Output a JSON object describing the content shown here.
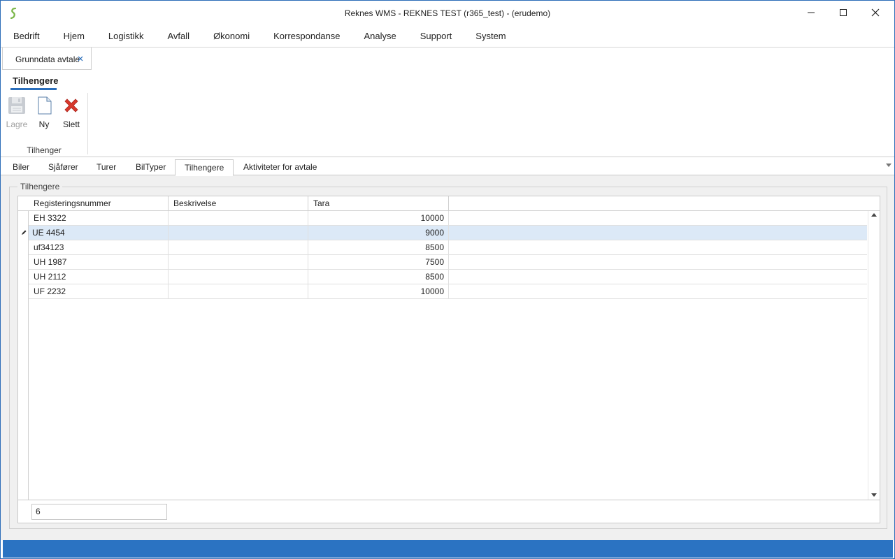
{
  "window": {
    "title": "Reknes WMS - REKNES TEST (r365_test) - (erudemo)"
  },
  "menu": {
    "items": [
      "Bedrift",
      "Hjem",
      "Logistikk",
      "Avfall",
      "Økonomi",
      "Korrespondanse",
      "Analyse",
      "Support",
      "System"
    ]
  },
  "doc_tab": {
    "label": "Grunndata avtale"
  },
  "ribbon": {
    "tab_label": "Tilhengere",
    "buttons": {
      "save": "Lagre",
      "new": "Ny",
      "delete": "Slett"
    },
    "group_label": "Tilhenger"
  },
  "content_tabs": {
    "items": [
      "Biler",
      "Sjåfører",
      "Turer",
      "BilTyper",
      "Tilhengere",
      "Aktiviteter for avtale"
    ],
    "active": "Tilhengere"
  },
  "groupbox": {
    "label": "Tilhengere"
  },
  "grid": {
    "columns": [
      "Registeringsnummer",
      "Beskrivelse",
      "Tara"
    ],
    "rows": [
      {
        "reg": "EH 3322",
        "desc": "",
        "tara": "10000"
      },
      {
        "reg": "UE 4454",
        "desc": "",
        "tara": "9000"
      },
      {
        "reg": "uf34123",
        "desc": "",
        "tara": "8500"
      },
      {
        "reg": "UH 1987",
        "desc": "",
        "tara": "7500"
      },
      {
        "reg": "UH 2112",
        "desc": "",
        "tara": "8500"
      },
      {
        "reg": "UF 2232",
        "desc": "",
        "tara": "10000"
      }
    ],
    "selected_row": 1,
    "row_count": "6"
  },
  "colors": {
    "accent": "#2a6ebb",
    "statusbar": "#2b73c2",
    "selected_row": "#dce9f7"
  }
}
